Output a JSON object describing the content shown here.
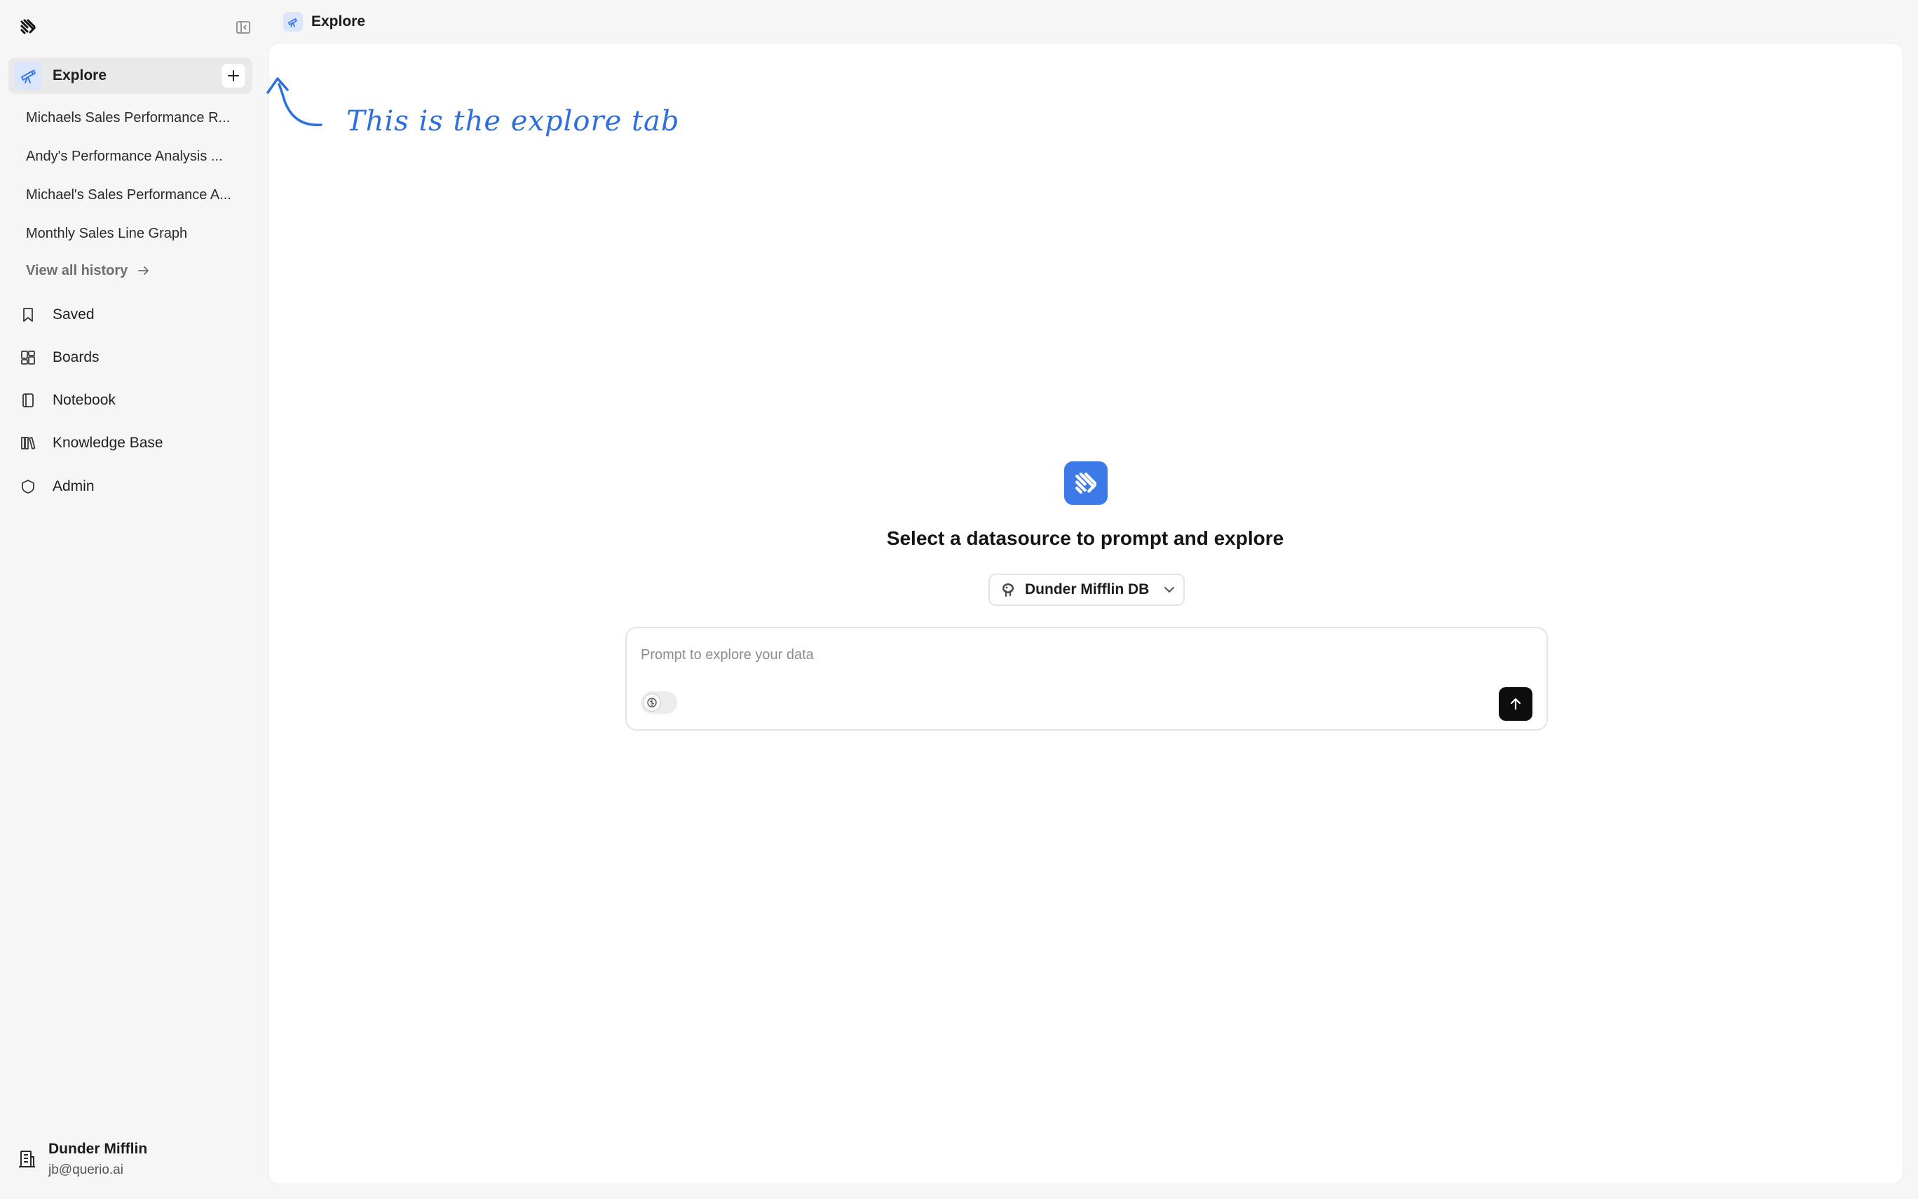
{
  "breadcrumb": {
    "label": "Explore"
  },
  "sidebar": {
    "explore_label": "Explore",
    "history": [
      "Michaels Sales Performance R...",
      "Andy's Performance Analysis ...",
      "Michael's Sales Performance A...",
      "Monthly Sales Line Graph"
    ],
    "view_all_label": "View all history",
    "nav": [
      {
        "label": "Saved",
        "icon": "bookmark-icon"
      },
      {
        "label": "Boards",
        "icon": "boards-icon"
      },
      {
        "label": "Notebook",
        "icon": "notebook-icon"
      },
      {
        "label": "Knowledge Base",
        "icon": "library-icon"
      },
      {
        "label": "Admin",
        "icon": "shield-icon"
      }
    ]
  },
  "org": {
    "name": "Dunder Mifflin",
    "email": "jb@querio.ai"
  },
  "annotation": {
    "text": "This is the explore tab"
  },
  "main": {
    "title": "Select a datasource to prompt and explore",
    "datasource": {
      "label": "Dunder Mifflin DB",
      "icon": "postgres-icon"
    },
    "prompt": {
      "placeholder": "Prompt to explore your data",
      "value": ""
    }
  },
  "colors": {
    "accent": "#3c7ae8",
    "accent_light": "#dbe6fb",
    "annotation": "#2e6fde"
  }
}
